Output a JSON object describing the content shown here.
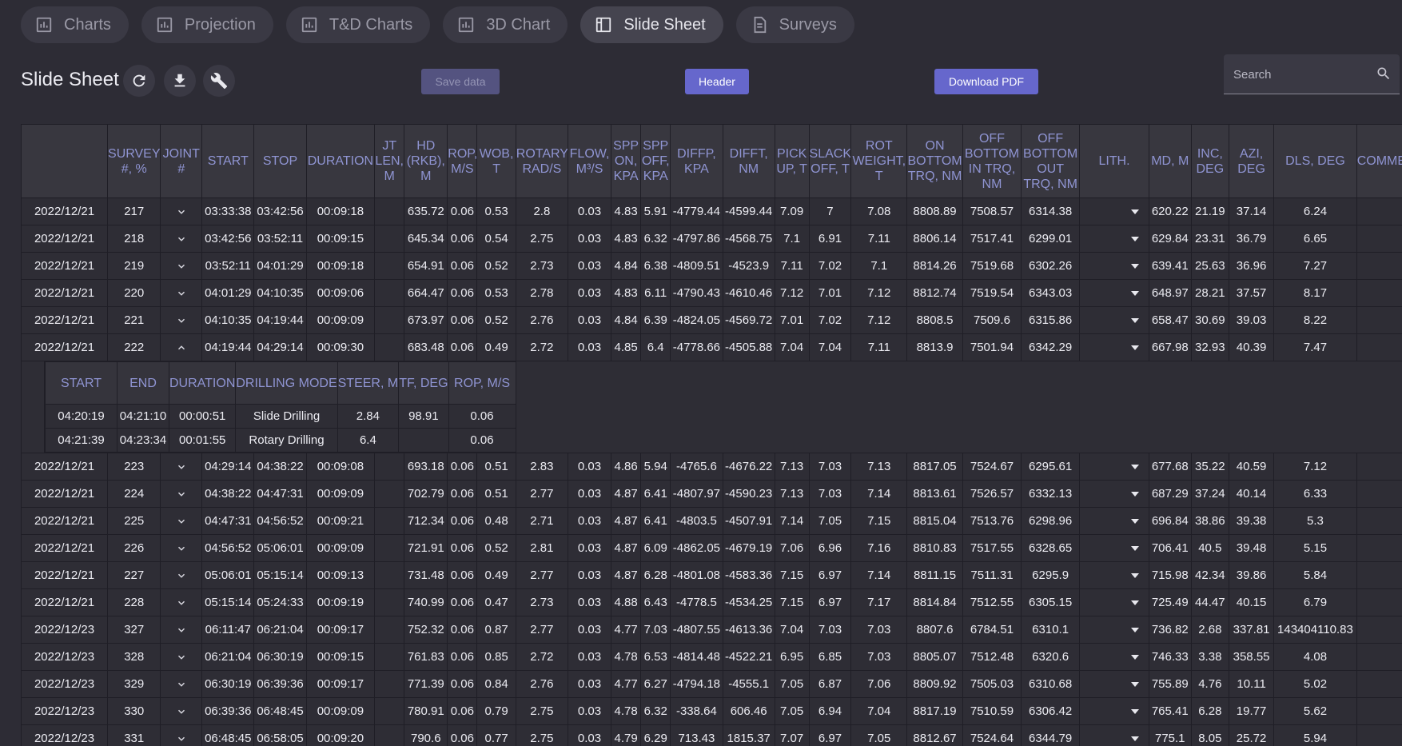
{
  "tabs": [
    {
      "label": "Charts",
      "icon": "bar-chart-icon"
    },
    {
      "label": "Projection",
      "icon": "bar-chart-icon"
    },
    {
      "label": "T&D Charts",
      "icon": "bar-chart-icon"
    },
    {
      "label": "3D Chart",
      "icon": "bar-chart-icon"
    },
    {
      "label": "Slide Sheet",
      "icon": "sheet-icon",
      "active": true
    },
    {
      "label": "Surveys",
      "icon": "document-icon"
    }
  ],
  "toolbar": {
    "title": "Slide Sheet",
    "save_label": "Save data",
    "header_label": "Header",
    "pdf_label": "Download PDF",
    "search_placeholder": "Search"
  },
  "colors": {
    "background": "#2d2c35",
    "accent": "#6667cc",
    "header_text": "#8f94d2"
  },
  "table": {
    "headers": [
      "",
      "SURVEY #, %",
      "JOINT #",
      "START",
      "STOP",
      "DURATION",
      "JT LEN, M",
      "HD (RKB), M",
      "ROP, M/S",
      "WOB, T",
      "ROTARY, RAD/S",
      "FLOW, M³/S",
      "SPP ON, KPA",
      "SPP OFF, KPA",
      "DIFFP, KPA",
      "DIFFT, NM",
      "PICK UP, T",
      "SLACK OFF, T",
      "ROT WEIGHT, T",
      "ON BOTTOM TRQ, NM",
      "OFF BOTTOM IN TRQ, NM",
      "OFF BOTTOM OUT TRQ, NM",
      "LITH.",
      "MD, M",
      "INC, DEG",
      "AZI, DEG",
      "DLS, DEG",
      "COMMENTS"
    ],
    "rows": [
      {
        "date": "2022/12/21",
        "survey": "217",
        "expanded": false,
        "start": "03:33:38",
        "stop": "03:42:56",
        "duration": "00:09:18",
        "jt_len": "",
        "hd": "635.72",
        "rop": "0.06",
        "wob": "0.53",
        "rotary": "2.8",
        "flow": "0.03",
        "spp_on": "4.83",
        "spp_off": "5.91",
        "diffp": "-4779.44",
        "difft": "-4599.44",
        "pick_up": "7.09",
        "slack_off": "7",
        "rot_weight": "7.08",
        "on_bottom": "8808.89",
        "off_in": "7508.57",
        "off_out": "6314.38",
        "lith": "",
        "md": "620.22",
        "inc": "21.19",
        "azi": "37.14",
        "dls": "6.24",
        "comment": ""
      },
      {
        "date": "2022/12/21",
        "survey": "218",
        "expanded": false,
        "start": "03:42:56",
        "stop": "03:52:11",
        "duration": "00:09:15",
        "jt_len": "",
        "hd": "645.34",
        "rop": "0.06",
        "wob": "0.54",
        "rotary": "2.75",
        "flow": "0.03",
        "spp_on": "4.83",
        "spp_off": "6.32",
        "diffp": "-4797.86",
        "difft": "-4568.75",
        "pick_up": "7.1",
        "slack_off": "6.91",
        "rot_weight": "7.11",
        "on_bottom": "8806.14",
        "off_in": "7517.41",
        "off_out": "6299.01",
        "lith": "",
        "md": "629.84",
        "inc": "23.31",
        "azi": "36.79",
        "dls": "6.65",
        "comment": ""
      },
      {
        "date": "2022/12/21",
        "survey": "219",
        "expanded": false,
        "start": "03:52:11",
        "stop": "04:01:29",
        "duration": "00:09:18",
        "jt_len": "",
        "hd": "654.91",
        "rop": "0.06",
        "wob": "0.52",
        "rotary": "2.73",
        "flow": "0.03",
        "spp_on": "4.84",
        "spp_off": "6.38",
        "diffp": "-4809.51",
        "difft": "-4523.9",
        "pick_up": "7.11",
        "slack_off": "7.02",
        "rot_weight": "7.1",
        "on_bottom": "8814.26",
        "off_in": "7519.68",
        "off_out": "6302.26",
        "lith": "",
        "md": "639.41",
        "inc": "25.63",
        "azi": "36.96",
        "dls": "7.27",
        "comment": ""
      },
      {
        "date": "2022/12/21",
        "survey": "220",
        "expanded": false,
        "start": "04:01:29",
        "stop": "04:10:35",
        "duration": "00:09:06",
        "jt_len": "",
        "hd": "664.47",
        "rop": "0.06",
        "wob": "0.53",
        "rotary": "2.78",
        "flow": "0.03",
        "spp_on": "4.83",
        "spp_off": "6.11",
        "diffp": "-4790.43",
        "difft": "-4610.46",
        "pick_up": "7.12",
        "slack_off": "7.01",
        "rot_weight": "7.12",
        "on_bottom": "8812.74",
        "off_in": "7519.54",
        "off_out": "6343.03",
        "lith": "",
        "md": "648.97",
        "inc": "28.21",
        "azi": "37.57",
        "dls": "8.17",
        "comment": ""
      },
      {
        "date": "2022/12/21",
        "survey": "221",
        "expanded": false,
        "start": "04:10:35",
        "stop": "04:19:44",
        "duration": "00:09:09",
        "jt_len": "",
        "hd": "673.97",
        "rop": "0.06",
        "wob": "0.52",
        "rotary": "2.76",
        "flow": "0.03",
        "spp_on": "4.84",
        "spp_off": "6.39",
        "diffp": "-4824.05",
        "difft": "-4569.72",
        "pick_up": "7.01",
        "slack_off": "7.02",
        "rot_weight": "7.12",
        "on_bottom": "8808.5",
        "off_in": "7509.6",
        "off_out": "6315.86",
        "lith": "",
        "md": "658.47",
        "inc": "30.69",
        "azi": "39.03",
        "dls": "8.22",
        "comment": ""
      },
      {
        "date": "2022/12/21",
        "survey": "222",
        "expanded": true,
        "start": "04:19:44",
        "stop": "04:29:14",
        "duration": "00:09:30",
        "jt_len": "",
        "hd": "683.48",
        "rop": "0.06",
        "wob": "0.49",
        "rotary": "2.72",
        "flow": "0.03",
        "spp_on": "4.85",
        "spp_off": "6.4",
        "diffp": "-4778.66",
        "difft": "-4505.88",
        "pick_up": "7.04",
        "slack_off": "7.04",
        "rot_weight": "7.11",
        "on_bottom": "8813.9",
        "off_in": "7501.94",
        "off_out": "6342.29",
        "lith": "",
        "md": "667.98",
        "inc": "32.93",
        "azi": "40.39",
        "dls": "7.47",
        "comment": ""
      },
      {
        "date": "2022/12/21",
        "survey": "223",
        "expanded": false,
        "start": "04:29:14",
        "stop": "04:38:22",
        "duration": "00:09:08",
        "jt_len": "",
        "hd": "693.18",
        "rop": "0.06",
        "wob": "0.51",
        "rotary": "2.83",
        "flow": "0.03",
        "spp_on": "4.86",
        "spp_off": "5.94",
        "diffp": "-4765.6",
        "difft": "-4676.22",
        "pick_up": "7.13",
        "slack_off": "7.03",
        "rot_weight": "7.13",
        "on_bottom": "8817.05",
        "off_in": "7524.67",
        "off_out": "6295.61",
        "lith": "",
        "md": "677.68",
        "inc": "35.22",
        "azi": "40.59",
        "dls": "7.12",
        "comment": ""
      },
      {
        "date": "2022/12/21",
        "survey": "224",
        "expanded": false,
        "start": "04:38:22",
        "stop": "04:47:31",
        "duration": "00:09:09",
        "jt_len": "",
        "hd": "702.79",
        "rop": "0.06",
        "wob": "0.51",
        "rotary": "2.77",
        "flow": "0.03",
        "spp_on": "4.87",
        "spp_off": "6.41",
        "diffp": "-4807.97",
        "difft": "-4590.23",
        "pick_up": "7.13",
        "slack_off": "7.03",
        "rot_weight": "7.14",
        "on_bottom": "8813.61",
        "off_in": "7526.57",
        "off_out": "6332.13",
        "lith": "",
        "md": "687.29",
        "inc": "37.24",
        "azi": "40.14",
        "dls": "6.33",
        "comment": ""
      },
      {
        "date": "2022/12/21",
        "survey": "225",
        "expanded": false,
        "start": "04:47:31",
        "stop": "04:56:52",
        "duration": "00:09:21",
        "jt_len": "",
        "hd": "712.34",
        "rop": "0.06",
        "wob": "0.48",
        "rotary": "2.71",
        "flow": "0.03",
        "spp_on": "4.87",
        "spp_off": "6.41",
        "diffp": "-4803.5",
        "difft": "-4507.91",
        "pick_up": "7.14",
        "slack_off": "7.05",
        "rot_weight": "7.15",
        "on_bottom": "8815.04",
        "off_in": "7513.76",
        "off_out": "6298.96",
        "lith": "",
        "md": "696.84",
        "inc": "38.86",
        "azi": "39.38",
        "dls": "5.3",
        "comment": ""
      },
      {
        "date": "2022/12/21",
        "survey": "226",
        "expanded": false,
        "start": "04:56:52",
        "stop": "05:06:01",
        "duration": "00:09:09",
        "jt_len": "",
        "hd": "721.91",
        "rop": "0.06",
        "wob": "0.52",
        "rotary": "2.81",
        "flow": "0.03",
        "spp_on": "4.87",
        "spp_off": "6.09",
        "diffp": "-4862.05",
        "difft": "-4679.19",
        "pick_up": "7.06",
        "slack_off": "6.96",
        "rot_weight": "7.16",
        "on_bottom": "8810.83",
        "off_in": "7517.55",
        "off_out": "6328.65",
        "lith": "",
        "md": "706.41",
        "inc": "40.5",
        "azi": "39.48",
        "dls": "5.15",
        "comment": ""
      },
      {
        "date": "2022/12/21",
        "survey": "227",
        "expanded": false,
        "start": "05:06:01",
        "stop": "05:15:14",
        "duration": "00:09:13",
        "jt_len": "",
        "hd": "731.48",
        "rop": "0.06",
        "wob": "0.49",
        "rotary": "2.77",
        "flow": "0.03",
        "spp_on": "4.87",
        "spp_off": "6.28",
        "diffp": "-4801.08",
        "difft": "-4583.36",
        "pick_up": "7.15",
        "slack_off": "6.97",
        "rot_weight": "7.14",
        "on_bottom": "8811.15",
        "off_in": "7511.31",
        "off_out": "6295.9",
        "lith": "",
        "md": "715.98",
        "inc": "42.34",
        "azi": "39.86",
        "dls": "5.84",
        "comment": ""
      },
      {
        "date": "2022/12/21",
        "survey": "228",
        "expanded": false,
        "start": "05:15:14",
        "stop": "05:24:33",
        "duration": "00:09:19",
        "jt_len": "",
        "hd": "740.99",
        "rop": "0.06",
        "wob": "0.47",
        "rotary": "2.73",
        "flow": "0.03",
        "spp_on": "4.88",
        "spp_off": "6.43",
        "diffp": "-4778.5",
        "difft": "-4534.25",
        "pick_up": "7.15",
        "slack_off": "6.97",
        "rot_weight": "7.17",
        "on_bottom": "8814.84",
        "off_in": "7512.55",
        "off_out": "6305.15",
        "lith": "",
        "md": "725.49",
        "inc": "44.47",
        "azi": "40.15",
        "dls": "6.79",
        "comment": ""
      },
      {
        "date": "2022/12/23",
        "survey": "327",
        "expanded": false,
        "start": "06:11:47",
        "stop": "06:21:04",
        "duration": "00:09:17",
        "jt_len": "",
        "hd": "752.32",
        "rop": "0.06",
        "wob": "0.87",
        "rotary": "2.77",
        "flow": "0.03",
        "spp_on": "4.77",
        "spp_off": "7.03",
        "diffp": "-4807.55",
        "difft": "-4613.36",
        "pick_up": "7.04",
        "slack_off": "7.03",
        "rot_weight": "7.03",
        "on_bottom": "8807.6",
        "off_in": "6784.51",
        "off_out": "6310.1",
        "lith": "",
        "md": "736.82",
        "inc": "2.68",
        "azi": "337.81",
        "dls": "143404110.83",
        "comment": ""
      },
      {
        "date": "2022/12/23",
        "survey": "328",
        "expanded": false,
        "start": "06:21:04",
        "stop": "06:30:19",
        "duration": "00:09:15",
        "jt_len": "",
        "hd": "761.83",
        "rop": "0.06",
        "wob": "0.85",
        "rotary": "2.72",
        "flow": "0.03",
        "spp_on": "4.78",
        "spp_off": "6.53",
        "diffp": "-4814.48",
        "difft": "-4522.21",
        "pick_up": "6.95",
        "slack_off": "6.85",
        "rot_weight": "7.03",
        "on_bottom": "8805.07",
        "off_in": "7512.48",
        "off_out": "6320.6",
        "lith": "",
        "md": "746.33",
        "inc": "3.38",
        "azi": "358.55",
        "dls": "4.08",
        "comment": ""
      },
      {
        "date": "2022/12/23",
        "survey": "329",
        "expanded": false,
        "start": "06:30:19",
        "stop": "06:39:36",
        "duration": "00:09:17",
        "jt_len": "",
        "hd": "771.39",
        "rop": "0.06",
        "wob": "0.84",
        "rotary": "2.76",
        "flow": "0.03",
        "spp_on": "4.77",
        "spp_off": "6.27",
        "diffp": "-4794.18",
        "difft": "-4555.1",
        "pick_up": "7.05",
        "slack_off": "6.87",
        "rot_weight": "7.06",
        "on_bottom": "8809.92",
        "off_in": "7505.03",
        "off_out": "6310.68",
        "lith": "",
        "md": "755.89",
        "inc": "4.76",
        "azi": "10.11",
        "dls": "5.02",
        "comment": ""
      },
      {
        "date": "2022/12/23",
        "survey": "330",
        "expanded": false,
        "start": "06:39:36",
        "stop": "06:48:45",
        "duration": "00:09:09",
        "jt_len": "",
        "hd": "780.91",
        "rop": "0.06",
        "wob": "0.79",
        "rotary": "2.75",
        "flow": "0.03",
        "spp_on": "4.78",
        "spp_off": "6.32",
        "diffp": "-338.64",
        "difft": "606.46",
        "pick_up": "7.05",
        "slack_off": "6.94",
        "rot_weight": "7.04",
        "on_bottom": "8817.19",
        "off_in": "7510.59",
        "off_out": "6306.42",
        "lith": "",
        "md": "765.41",
        "inc": "6.28",
        "azi": "19.77",
        "dls": "5.62",
        "comment": ""
      },
      {
        "date": "2022/12/23",
        "survey": "331",
        "expanded": false,
        "start": "06:48:45",
        "stop": "06:58:05",
        "duration": "00:09:20",
        "jt_len": "",
        "hd": "790.6",
        "rop": "0.06",
        "wob": "0.77",
        "rotary": "2.75",
        "flow": "0.03",
        "spp_on": "4.79",
        "spp_off": "6.29",
        "diffp": "713.43",
        "difft": "1815.37",
        "pick_up": "7.07",
        "slack_off": "6.97",
        "rot_weight": "7.05",
        "on_bottom": "8812.67",
        "off_in": "7524.64",
        "off_out": "6344.79",
        "lith": "",
        "md": "775.1",
        "inc": "8.05",
        "azi": "25.72",
        "dls": "5.94",
        "comment": ""
      }
    ],
    "subtable": {
      "after_row": 5,
      "headers": [
        "START",
        "END",
        "DURATION",
        "DRILLING MODE",
        "STEER, M",
        "TF, DEG",
        "ROP, M/S"
      ],
      "rows": [
        [
          "04:20:19",
          "04:21:10",
          "00:00:51",
          "Slide Drilling",
          "2.84",
          "98.91",
          "0.06"
        ],
        [
          "04:21:39",
          "04:23:34",
          "00:01:55",
          "Rotary Drilling",
          "6.4",
          "",
          "0.06"
        ]
      ]
    }
  }
}
